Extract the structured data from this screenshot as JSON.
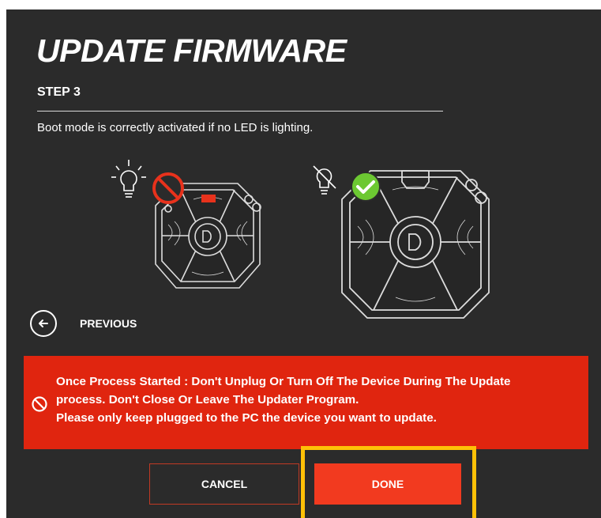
{
  "header": {
    "title": "UPDATE FIRMWARE",
    "step": "STEP 3",
    "description": "Boot mode is correctly activated if no LED is lighting."
  },
  "illustrations": {
    "left": {
      "led_icon": "lit-bulb-icon",
      "status_icon": "prohibited-icon",
      "state": "incorrect",
      "led_color": "#e8321c"
    },
    "right": {
      "led_icon": "unlit-bulb-icon",
      "status_icon": "check-icon",
      "state": "correct",
      "check_color": "#6cc832"
    }
  },
  "navigation": {
    "previous_label": "PREVIOUS",
    "previous_icon": "arrow-left-icon"
  },
  "warning": {
    "icon": "prohibited-icon",
    "line1": "Once Process Started : Don't Unplug Or Turn Off The Device During The Update",
    "line2": "process. Don't Close Or Leave The Updater Program.",
    "line3": "Please only keep plugged to the PC the device you want to update.",
    "background": "#e0250f"
  },
  "buttons": {
    "cancel_label": "CANCEL",
    "done_label": "DONE"
  },
  "colors": {
    "panel_background": "#2b2b2b",
    "accent": "#f23a1f",
    "highlight": "#ffc107"
  }
}
